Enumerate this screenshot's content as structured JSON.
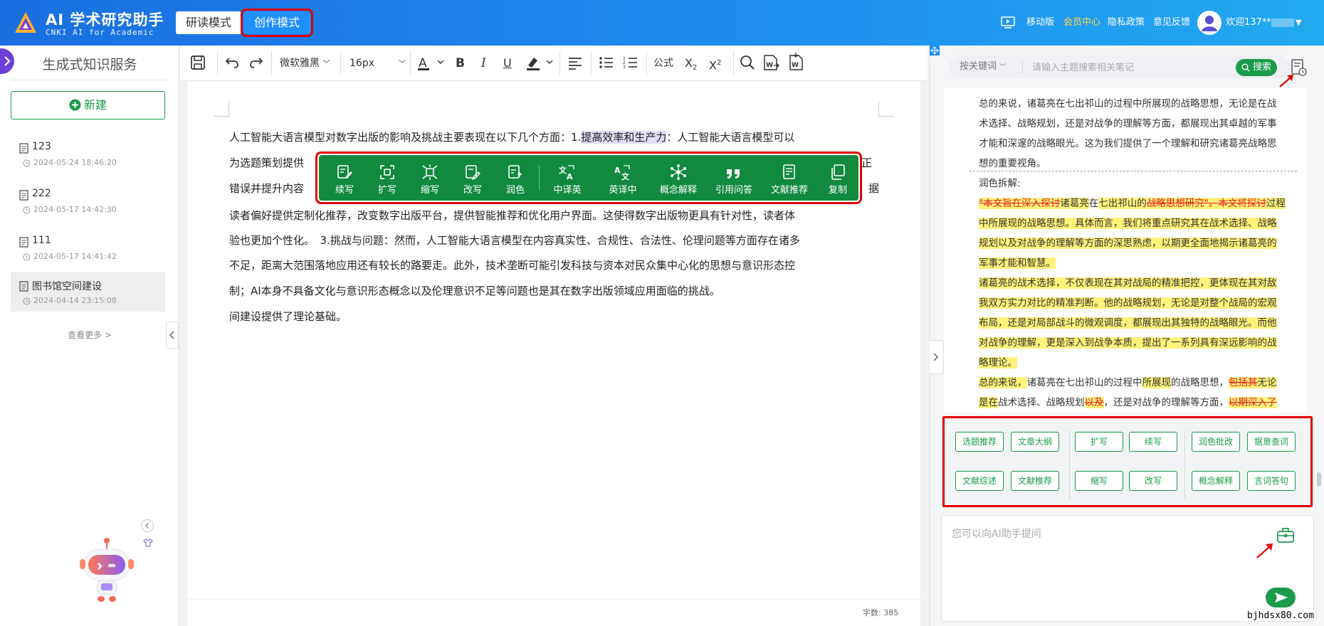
{
  "header": {
    "app_title": "AI 学术研究助手",
    "app_subtitle": "CNKI AI for Academic",
    "mode_read": "研读模式",
    "mode_create": "创作模式",
    "mobile": "移动版",
    "member": "会员中心",
    "privacy": "隐私政策",
    "feedback": "意见反馈",
    "welcome": "欢迎137**"
  },
  "sidebar": {
    "title": "生成式知识服务",
    "new_label": "新建",
    "docs": [
      {
        "name": "123",
        "time": "2024-05-24 18:46:20"
      },
      {
        "name": "222",
        "time": "2024-05-17 14:42:30"
      },
      {
        "name": "111",
        "time": "2024-05-17 14:41:42"
      },
      {
        "name": "图书馆空间建设",
        "time": "2024-04-14 23:15:08"
      }
    ],
    "see_more": "查看更多 >"
  },
  "toolbar": {
    "font_family": "微软雅黑",
    "font_size": "16px",
    "formula": "公式"
  },
  "editor": {
    "line1_a": "人工智能大语言模型对数字出版的影响及挑战主要表现在以下几个方面：1.",
    "line1_hl": "提高效率和生产力",
    "line1_b": "：人工智能大语言模型可以",
    "line2_a": "为选题策划提供",
    "line2_b": "正",
    "line3_a": "错误并提升内容",
    "line3_b": "据",
    "line4": "读者偏好提供定制化推荐，改变数字出版平台，提供智能推荐和优化用户界面。这使得数字出版物更具有针对性，读者体",
    "line5": "验也更加个性化。　3.挑战与问题：然而，人工智能大语言模型在内容真实性、合规性、合法性、伦理问题等方面存在诸多",
    "line6": "不足，距离大范围落地应用还有较长的路要走。此外，技术垄断可能引发科技与资本对民众集中心化的思想与意识形态控",
    "line7": "制；AI本身不具备文化与意识形态概念以及伦理意识不足等问题也是其在数字出版领域应用面临的挑战。",
    "line8": "间建设提供了理论基础。",
    "word_count": "字数: 385"
  },
  "float_toolbar": [
    {
      "label": "续写",
      "icon": "continue-write-icon"
    },
    {
      "label": "扩写",
      "icon": "expand-icon"
    },
    {
      "label": "缩写",
      "icon": "shrink-icon"
    },
    {
      "label": "改写",
      "icon": "rewrite-icon"
    },
    {
      "label": "润色",
      "icon": "polish-icon"
    },
    {
      "label": "中译英",
      "icon": "translate-zh-en-icon"
    },
    {
      "label": "英译中",
      "icon": "translate-en-zh-icon"
    },
    {
      "label": "概念解释",
      "icon": "concept-icon"
    },
    {
      "label": "引用问答",
      "icon": "quote-icon"
    },
    {
      "label": "文献推荐",
      "icon": "document-icon"
    },
    {
      "label": "复制",
      "icon": "copy-icon"
    }
  ],
  "right": {
    "keyword_select": "按关键词",
    "search_placeholder": "请输入主题搜索相关笔记",
    "search_btn": "搜索",
    "summary_1": "总的来说，诸葛亮在七出祁山的过程中所展现的战略思想，无论是在战",
    "summary_2": "术选择、战略规划，还是对战争的理解等方面，都展现出其卓越的军事",
    "summary_3": "才能和深邃的战略眼光。这为我们提供了一个理解和研究诸葛亮战略思",
    "summary_4": "想的重要视角。",
    "polish_label": "润色拆解:",
    "p1_del": "\"本文旨在深入探讨",
    "p1_a": "诸葛亮",
    "p1_b": "在",
    "p1_c": "七出祁山的",
    "p1_del2": "战略思想研究\"。本文将探讨",
    "p1_d": "过程",
    "p2": "中所展现的战略思想。具体而言，我们将重点研究其在战术选择、战略",
    "p3": "规划以及对战争的理解等方面的深思熟虑，以期更全面地揭示诸葛亮的",
    "p4": "军事才能和智慧。",
    "p5": "诸葛亮的战术选择，不仅表现在其对战局的精准把控，更体现在其对敌",
    "p6": "我双方实力对比的精准判断。他的战略规划，无论是对整个战局的宏观",
    "p7": "布局，还是对局部战斗的微观调度，都展现出其独特的战略眼光。而他",
    "p8": "对战争的理解，更是深入到战争本质，提出了一系列具有深远影响的战",
    "p9": "略理论。",
    "p10_a": "总的来说，",
    "p10_b": "诸葛亮在七出祁山的过程中",
    "p10_c": "所展现",
    "p10_d": "的战略思想，",
    "p10_del": "包括其",
    "p10_e": "无论",
    "p11_a": "是在",
    "p11_b": "战术选择、战略规划",
    "p11_del": "以及",
    "p11_c": "，还是对战争的理解等方面，",
    "p11_del2": "以期深入了",
    "actions": [
      "选题推荐",
      "文章大纲",
      "扩写",
      "续写",
      "润色批改",
      "据意查词",
      "文献综述",
      "文献推荐",
      "缩写",
      "改写",
      "概念解释",
      "言词答句"
    ],
    "input_placeholder": "您可以向AI助手提问"
  },
  "watermark": "bjhdsx80.com",
  "colors": {
    "header": "#1a6fe0",
    "green": "#128a3e",
    "highlight_yellow": "#fff27a",
    "delete_red": "#e02020",
    "annot_red": "#e00000"
  }
}
